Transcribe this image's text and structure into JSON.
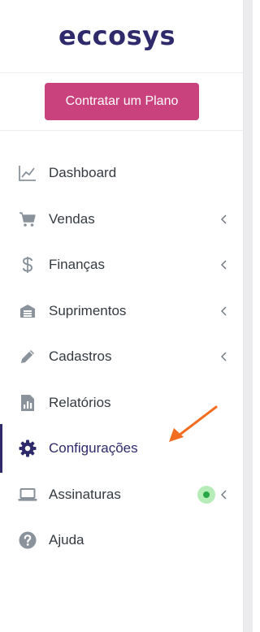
{
  "brand": {
    "logo_text": "eccosys"
  },
  "cta": {
    "label": "Contratar um Plano"
  },
  "colors": {
    "brand_navy": "#2f2a6b",
    "cta_pink": "#c9417d",
    "icon_gray": "#8a939c",
    "status_green": "#27a745",
    "arrow_orange": "#f26d21"
  },
  "menu": {
    "items": [
      {
        "label": "Dashboard",
        "icon": "line-chart-icon",
        "has_submenu": false
      },
      {
        "label": "Vendas",
        "icon": "cart-icon",
        "has_submenu": true
      },
      {
        "label": "Finanças",
        "icon": "dollar-icon",
        "has_submenu": true
      },
      {
        "label": "Suprimentos",
        "icon": "warehouse-icon",
        "has_submenu": true
      },
      {
        "label": "Cadastros",
        "icon": "pencil-icon",
        "has_submenu": true
      },
      {
        "label": "Relatórios",
        "icon": "report-icon",
        "has_submenu": false
      },
      {
        "label": "Configurações",
        "icon": "gear-icon",
        "has_submenu": false,
        "active": true
      },
      {
        "label": "Assinaturas",
        "icon": "laptop-icon",
        "has_submenu": true,
        "status": "online"
      },
      {
        "label": "Ajuda",
        "icon": "help-icon",
        "has_submenu": false
      }
    ]
  },
  "annotation": {
    "icon": "arrow-pointer-icon"
  }
}
